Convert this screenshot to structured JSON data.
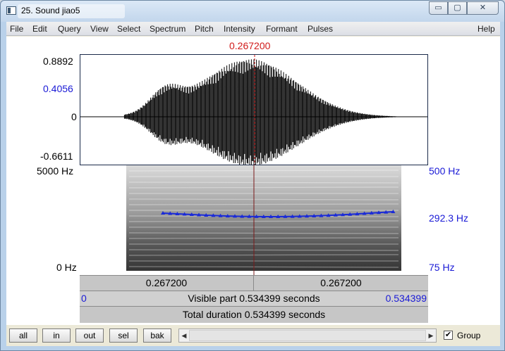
{
  "window": {
    "title": "25. Sound jiao5",
    "controls": {
      "minimize": "▭",
      "maximize": "▢",
      "close": "✕"
    }
  },
  "menu": [
    "File",
    "Edit",
    "Query",
    "View",
    "Select",
    "Spectrum",
    "Pitch",
    "Intensity",
    "Formant",
    "Pulses",
    "Help"
  ],
  "cursor": {
    "time_label": "0.267200",
    "time": 0.2672
  },
  "waveform": {
    "y_top": "0.8892",
    "y_selection": "0.4056",
    "y_zero": "0",
    "y_bottom": "-0.6611"
  },
  "spectrogram": {
    "freq_top": "5000 Hz",
    "freq_bottom": "0 Hz",
    "pitch_top": "500 Hz",
    "pitch_current": "292.3 Hz",
    "pitch_bottom": "75 Hz"
  },
  "time_bars": {
    "left_segment": "0.267200",
    "right_segment": "0.267200",
    "visible_start": "0",
    "visible_label": "Visible part 0.534399 seconds",
    "visible_end": "0.534399",
    "total_label": "Total duration 0.534399 seconds"
  },
  "buttons": {
    "all": "all",
    "in": "in",
    "out": "out",
    "sel": "sel",
    "bak": "bak"
  },
  "scrollbar": {
    "left_arrow": "◀",
    "right_arrow": "▶"
  },
  "group": {
    "label": "Group",
    "checked": true,
    "check_mark": "✔"
  },
  "colors": {
    "cursor": "#d11a1a",
    "pitch": "#1a2ad8",
    "axis_blue": "#1a1ad6"
  }
}
